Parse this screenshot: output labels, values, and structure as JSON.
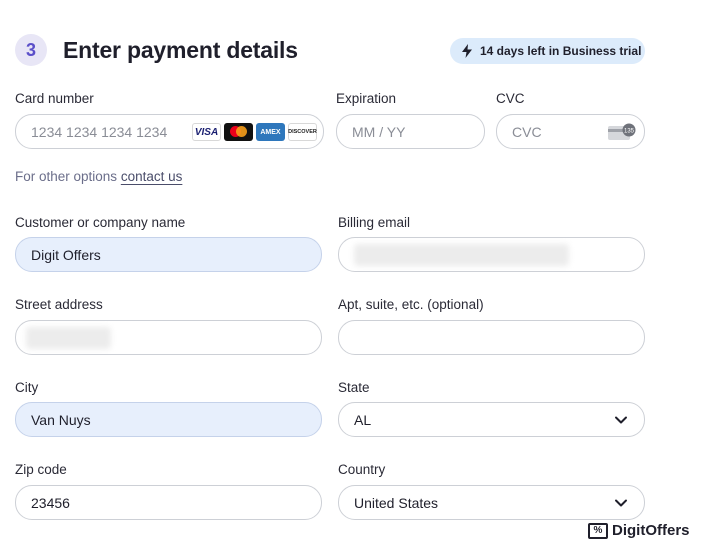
{
  "header": {
    "step_number": "3",
    "title": "Enter payment details",
    "trial_badge": "14 days left in Business trial"
  },
  "card": {
    "number_label": "Card number",
    "number_placeholder": "1234 1234 1234 1234",
    "brands": [
      "VISA",
      "Mastercard",
      "AMEX",
      "DISCOVER"
    ],
    "expiration_label": "Expiration",
    "expiration_placeholder": "MM / YY",
    "cvc_label": "CVC",
    "cvc_placeholder": "CVC",
    "cvc_icon_text": "135"
  },
  "other_options": {
    "prefix": "For other options ",
    "link": "contact us"
  },
  "form": {
    "company_label": "Customer or company name",
    "company_value": "Digit Offers",
    "email_label": "Billing email",
    "street_label": "Street address",
    "apt_label": "Apt, suite, etc. (optional)",
    "city_label": "City",
    "city_value": "Van Nuys",
    "state_label": "State",
    "state_value": "AL",
    "zip_label": "Zip code",
    "zip_value": "23456",
    "country_label": "Country",
    "country_value": "United States"
  },
  "watermark": {
    "text": "DigitOffers"
  },
  "colors": {
    "accent": "#5b4fc9",
    "badge_bg": "#dcebfb",
    "filled_field_bg": "#e7effc"
  }
}
